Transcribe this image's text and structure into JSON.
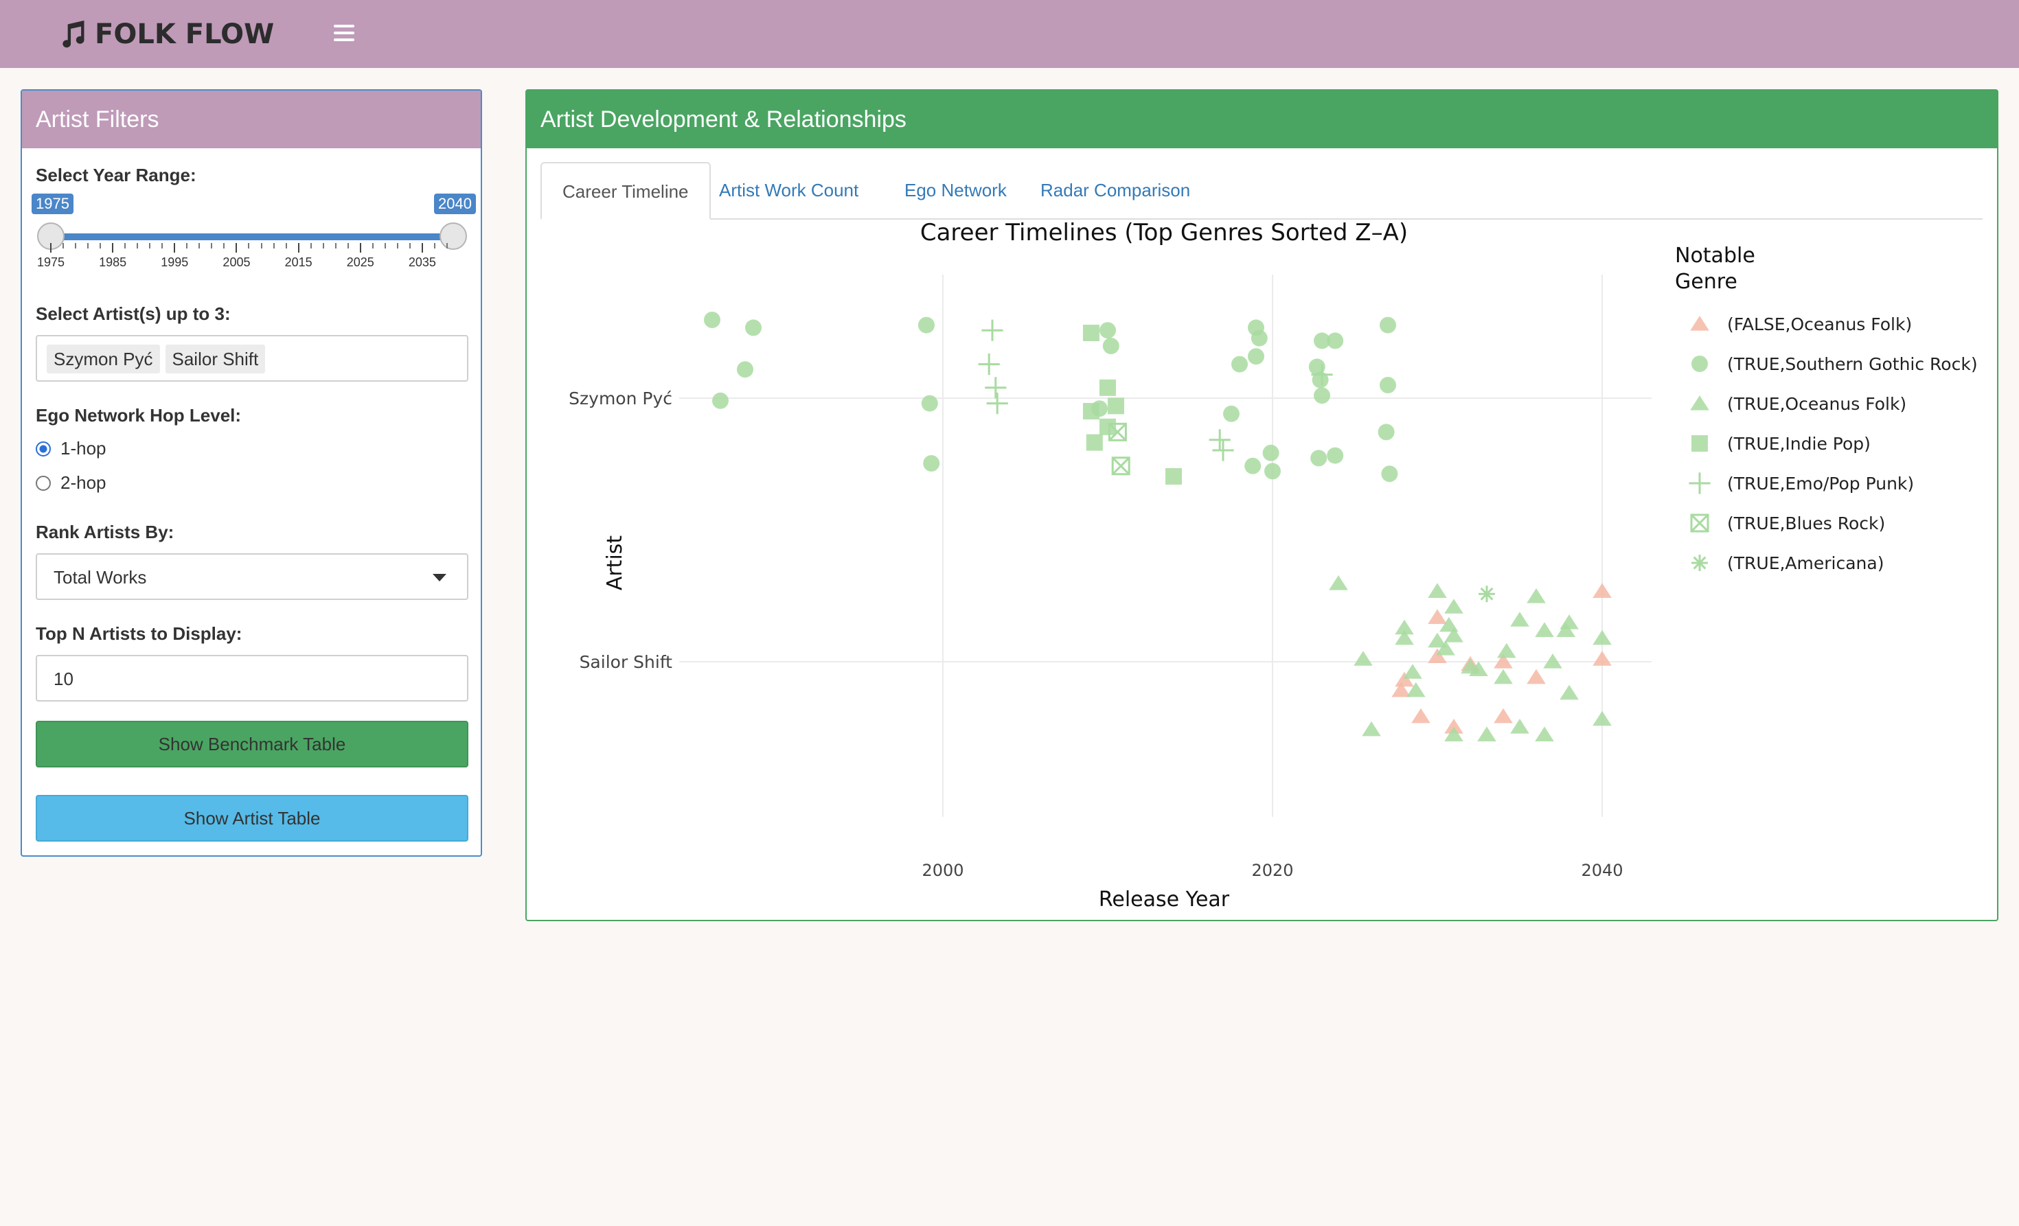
{
  "app": {
    "title": "FOLK FLOW"
  },
  "filters": {
    "header": "Artist Filters",
    "year_range": {
      "label": "Select Year Range:",
      "min": 1975,
      "max": 2040,
      "from": 1975,
      "to": 2040,
      "from_label": "1975",
      "to_label": "2040",
      "tick_labels": [
        "1975",
        "1985",
        "1995",
        "2005",
        "2015",
        "2025",
        "2035"
      ]
    },
    "artists": {
      "label": "Select Artist(s) up to 3:",
      "selected": [
        "Szymon Pyć",
        "Sailor Shift"
      ]
    },
    "hop": {
      "label": "Ego Network Hop Level:",
      "options": [
        "1-hop",
        "2-hop"
      ],
      "selected": "1-hop"
    },
    "rank": {
      "label": "Rank Artists By:",
      "value": "Total Works"
    },
    "topn": {
      "label": "Top N Artists to Display:",
      "value": "10"
    },
    "buttons": {
      "benchmark": "Show Benchmark Table",
      "artist_table": "Show Artist Table"
    }
  },
  "main": {
    "header": "Artist Development & Relationships",
    "tabs": [
      "Career Timeline",
      "Artist Work Count",
      "Ego Network",
      "Radar Comparison"
    ],
    "active_tab": "Career Timeline"
  },
  "chart_data": {
    "type": "scatter",
    "title": "Career Timelines (Top Genres Sorted Z–A)",
    "xlabel": "Release Year",
    "ylabel": "Artist",
    "x_ticks": [
      2000,
      2020,
      2040
    ],
    "xlim": [
      1984,
      2043
    ],
    "categories": [
      "Szymon Pyć",
      "Sailor Shift"
    ],
    "grid": true,
    "legend_title": "Notable\nGenre",
    "legend_position": "right",
    "series": [
      {
        "name": "(FALSE,Oceanus Folk)",
        "shape": "triangle",
        "color": "#f4b8a4",
        "points": [
          [
            2030,
            "Sailor Shift",
            0.17
          ],
          [
            2028,
            "Sailor Shift",
            -0.07
          ],
          [
            2030,
            "Sailor Shift",
            0.02
          ],
          [
            2027.8,
            "Sailor Shift",
            -0.11
          ],
          [
            2032,
            "Sailor Shift",
            -0.01
          ],
          [
            2034,
            "Sailor Shift",
            0.0
          ],
          [
            2036,
            "Sailor Shift",
            -0.06
          ],
          [
            2029,
            "Sailor Shift",
            -0.21
          ],
          [
            2031,
            "Sailor Shift",
            -0.25
          ],
          [
            2034,
            "Sailor Shift",
            -0.21
          ],
          [
            2040,
            "Sailor Shift",
            0.27
          ],
          [
            2040,
            "Sailor Shift",
            0.01
          ]
        ]
      },
      {
        "name": "(TRUE,Southern Gothic Rock)",
        "shape": "circle",
        "color": "#a8dba0",
        "points": [
          [
            1986,
            "Szymon Pyć",
            0.3
          ],
          [
            1988.5,
            "Szymon Pyć",
            0.27
          ],
          [
            1988,
            "Szymon Pyć",
            0.11
          ],
          [
            1986.5,
            "Szymon Pyć",
            -0.01
          ],
          [
            1999,
            "Szymon Pyć",
            0.28
          ],
          [
            1999.2,
            "Szymon Pyć",
            -0.02
          ],
          [
            1999.3,
            "Szymon Pyć",
            -0.25
          ],
          [
            2010,
            "Szymon Pyć",
            0.26
          ],
          [
            2010.2,
            "Szymon Pyć",
            0.2
          ],
          [
            2009.5,
            "Szymon Pyć",
            -0.04
          ],
          [
            2019,
            "Szymon Pyć",
            0.27
          ],
          [
            2019.2,
            "Szymon Pyć",
            0.23
          ],
          [
            2019,
            "Szymon Pyć",
            0.16
          ],
          [
            2018,
            "Szymon Pyć",
            0.13
          ],
          [
            2017.5,
            "Szymon Pyć",
            -0.06
          ],
          [
            2018.8,
            "Szymon Pyć",
            -0.26
          ],
          [
            2019.9,
            "Szymon Pyć",
            -0.21
          ],
          [
            2020,
            "Szymon Pyć",
            -0.28
          ],
          [
            2023,
            "Szymon Pyć",
            0.22
          ],
          [
            2023.8,
            "Szymon Pyć",
            0.22
          ],
          [
            2022.7,
            "Szymon Pyć",
            0.12
          ],
          [
            2022.9,
            "Szymon Pyć",
            0.07
          ],
          [
            2023,
            "Szymon Pyć",
            0.01
          ],
          [
            2022.8,
            "Szymon Pyć",
            -0.23
          ],
          [
            2023.8,
            "Szymon Pyć",
            -0.22
          ],
          [
            2027,
            "Szymon Pyć",
            0.28
          ],
          [
            2027,
            "Szymon Pyć",
            0.05
          ],
          [
            2026.9,
            "Szymon Pyć",
            -0.13
          ],
          [
            2027.1,
            "Szymon Pyć",
            -0.29
          ]
        ]
      },
      {
        "name": "(TRUE,Oceanus Folk)",
        "shape": "triangle",
        "color": "#a8dba0",
        "points": [
          [
            2024,
            "Sailor Shift",
            0.3
          ],
          [
            2030,
            "Sailor Shift",
            0.27
          ],
          [
            2031,
            "Sailor Shift",
            0.21
          ],
          [
            2036,
            "Sailor Shift",
            0.25
          ],
          [
            2028,
            "Sailor Shift",
            0.13
          ],
          [
            2030.7,
            "Sailor Shift",
            0.14
          ],
          [
            2031,
            "Sailor Shift",
            0.1
          ],
          [
            2028,
            "Sailor Shift",
            0.09
          ],
          [
            2030,
            "Sailor Shift",
            0.08
          ],
          [
            2030.5,
            "Sailor Shift",
            0.05
          ],
          [
            2035,
            "Sailor Shift",
            0.16
          ],
          [
            2036.5,
            "Sailor Shift",
            0.12
          ],
          [
            2038,
            "Sailor Shift",
            0.15
          ],
          [
            2037.8,
            "Sailor Shift",
            0.12
          ],
          [
            2040,
            "Sailor Shift",
            0.09
          ],
          [
            2025.5,
            "Sailor Shift",
            0.01
          ],
          [
            2028.5,
            "Sailor Shift",
            -0.04
          ],
          [
            2032,
            "Sailor Shift",
            -0.02
          ],
          [
            2032.5,
            "Sailor Shift",
            -0.03
          ],
          [
            2034,
            "Sailor Shift",
            -0.06
          ],
          [
            2034.2,
            "Sailor Shift",
            0.04
          ],
          [
            2037,
            "Sailor Shift",
            0.0
          ],
          [
            2028.7,
            "Sailor Shift",
            -0.11
          ],
          [
            2038,
            "Sailor Shift",
            -0.12
          ],
          [
            2026,
            "Sailor Shift",
            -0.26
          ],
          [
            2031,
            "Sailor Shift",
            -0.28
          ],
          [
            2033,
            "Sailor Shift",
            -0.28
          ],
          [
            2035,
            "Sailor Shift",
            -0.25
          ],
          [
            2036.5,
            "Sailor Shift",
            -0.28
          ],
          [
            2040,
            "Sailor Shift",
            -0.22
          ]
        ]
      },
      {
        "name": "(TRUE,Indie Pop)",
        "shape": "square",
        "color": "#a8dba0",
        "points": [
          [
            2009,
            "Szymon Pyć",
            0.25
          ],
          [
            2010,
            "Szymon Pyć",
            0.04
          ],
          [
            2010.5,
            "Szymon Pyć",
            -0.03
          ],
          [
            2009,
            "Szymon Pyć",
            -0.05
          ],
          [
            2010,
            "Szymon Pyć",
            -0.11
          ],
          [
            2009.2,
            "Szymon Pyć",
            -0.17
          ],
          [
            2014,
            "Szymon Pyć",
            -0.3
          ]
        ]
      },
      {
        "name": "(TRUE,Emo/Pop Punk)",
        "shape": "plus",
        "color": "#a8dba0",
        "points": [
          [
            2003,
            "Szymon Pyć",
            0.26
          ],
          [
            2002.8,
            "Szymon Pyć",
            0.13
          ],
          [
            2003.2,
            "Szymon Pyć",
            0.04
          ],
          [
            2003.3,
            "Szymon Pyć",
            -0.02
          ],
          [
            2016.8,
            "Szymon Pyć",
            -0.16
          ],
          [
            2017,
            "Szymon Pyć",
            -0.2
          ],
          [
            2023,
            "Szymon Pyć",
            0.09
          ]
        ]
      },
      {
        "name": "(TRUE,Blues Rock)",
        "shape": "boxx",
        "color": "#a8dba0",
        "points": [
          [
            2010.6,
            "Szymon Pyć",
            -0.13
          ],
          [
            2010.8,
            "Szymon Pyć",
            -0.26
          ]
        ]
      },
      {
        "name": "(TRUE,Americana)",
        "shape": "asterisk",
        "color": "#a8dba0",
        "points": [
          [
            2033,
            "Sailor Shift",
            0.26
          ]
        ]
      }
    ]
  },
  "icons": {
    "brand": "music-note-icon",
    "menu": "hamburger-menu-icon"
  }
}
